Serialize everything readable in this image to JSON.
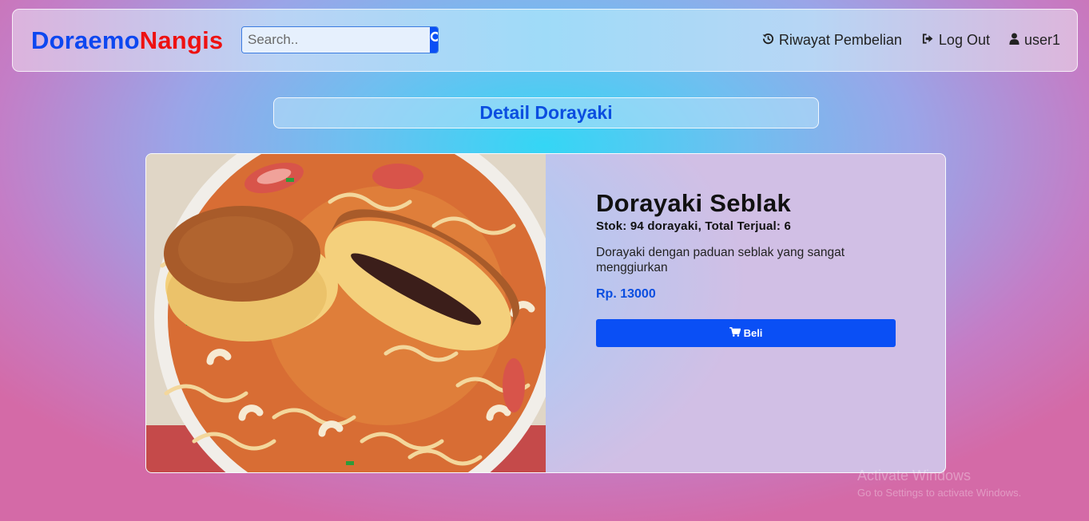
{
  "navbar": {
    "brand_part1": "Doraemo",
    "brand_part2": "Nangis",
    "search_placeholder": "Search..",
    "links": [
      {
        "label": "Riwayat Pembelian",
        "icon": "history-icon"
      },
      {
        "label": "Log Out",
        "icon": "sign-out-icon"
      },
      {
        "label": "user1",
        "icon": "user-icon"
      }
    ]
  },
  "page_title": "Detail Dorayaki",
  "product": {
    "image_alt": "Dorayaki Seblak",
    "name": "Dorayaki Seblak",
    "stock_line": "Stok: 94 dorayaki, Total Terjual: 6",
    "description": "Dorayaki dengan paduan seblak yang sangat menggiurkan",
    "price": "Rp. 13000",
    "buy_label": "Beli",
    "buy_icon": "cart-icon"
  },
  "watermark": {
    "line1": "Activate Windows",
    "line2": "Go to Settings to activate Windows."
  },
  "colors": {
    "primary": "#0a4ff5",
    "brand_blue": "#0d47f0",
    "brand_red": "#ee1111"
  }
}
